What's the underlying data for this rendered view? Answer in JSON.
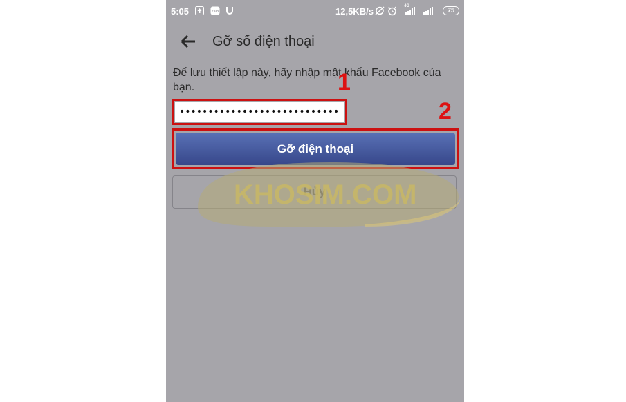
{
  "status_bar": {
    "time": "5:05",
    "speed": "12,5KB/s",
    "battery": "75",
    "net_label": "4G",
    "zalo_label": "Zalo"
  },
  "header": {
    "title": "Gỡ số điện thoại"
  },
  "instruction": "Để lưu thiết lập này, hãy nhập mật khẩu Facebook của bạn.",
  "password": {
    "value": "••••••••••••••••••••••••••••"
  },
  "buttons": {
    "remove_phone": "Gỡ điện thoại",
    "cancel": "Hủy"
  },
  "watermark": "KHOSIM.COM",
  "markers": {
    "one": "1",
    "two": "2"
  },
  "colors": {
    "overlay": "#a6a5aa",
    "primary_button": "#4a5ea3",
    "highlight": "#cc1111"
  }
}
